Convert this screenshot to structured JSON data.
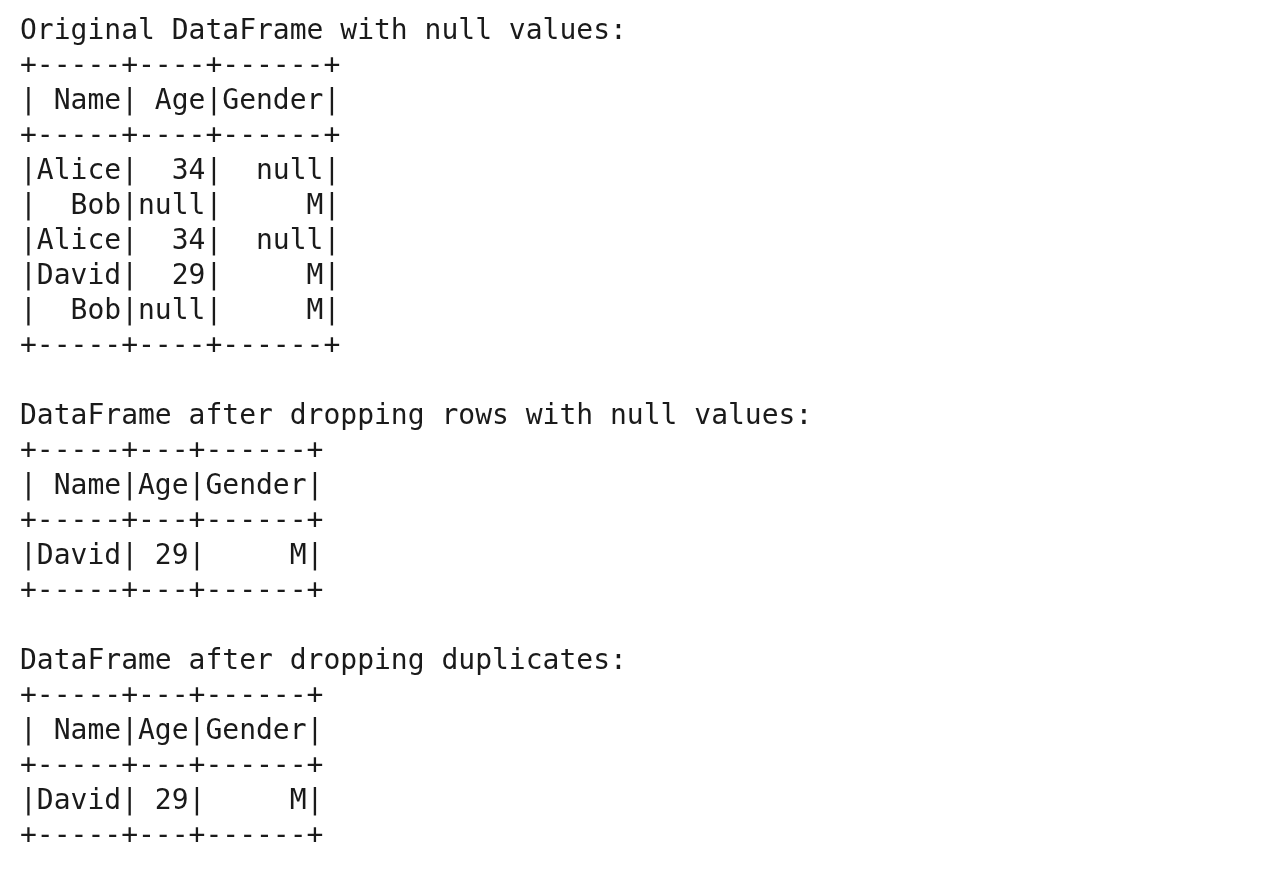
{
  "console_output": [
    {
      "heading": "Original DataFrame with null values:",
      "table_lines": [
        "+-----+----+------+",
        "| Name| Age|Gender|",
        "+-----+----+------+",
        "|Alice|  34|  null|",
        "|  Bob|null|     M|",
        "|Alice|  34|  null|",
        "|David|  29|     M|",
        "|  Bob|null|     M|",
        "+-----+----+------+"
      ]
    },
    {
      "heading": "DataFrame after dropping rows with null values:",
      "table_lines": [
        "+-----+---+------+",
        "| Name|Age|Gender|",
        "+-----+---+------+",
        "|David| 29|     M|",
        "+-----+---+------+"
      ]
    },
    {
      "heading": "DataFrame after dropping duplicates:",
      "table_lines": [
        "+-----+---+------+",
        "| Name|Age|Gender|",
        "+-----+---+------+",
        "|David| 29|     M|",
        "+-----+---+------+"
      ]
    }
  ]
}
